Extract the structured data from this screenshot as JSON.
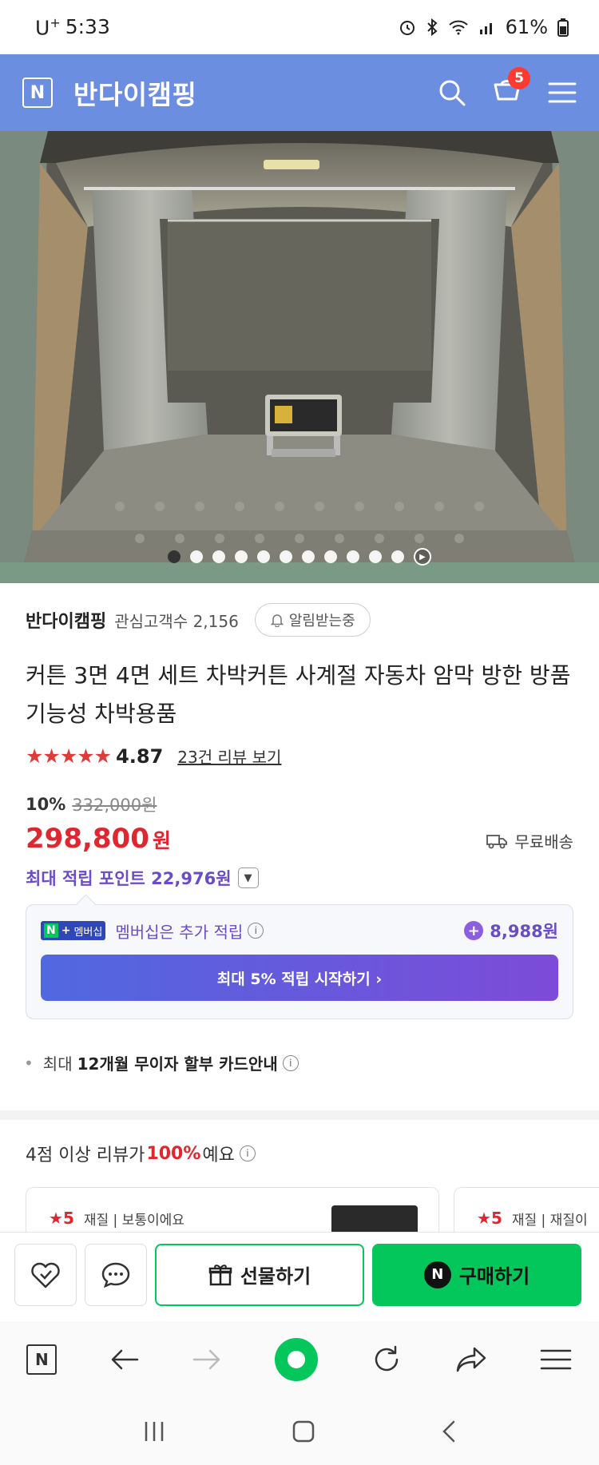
{
  "status_bar": {
    "carrier": "U",
    "carrier_plus": "+",
    "time": "5:33",
    "battery": "61%"
  },
  "header": {
    "logo_letter": "N",
    "store_name": "반다이캠핑",
    "cart_count": "5"
  },
  "gallery": {
    "dot_count": 11,
    "active_index": 0
  },
  "seller": {
    "name": "반다이캠핑",
    "followers_label": "관심고객수",
    "followers_count": "2,156",
    "alarm_label": "알림받는중"
  },
  "product": {
    "title": "커튼 3면 4면 세트 차박커튼 사계절 자동차 암막 방한 방품 기능성 차박용품",
    "stars": "★★★★★",
    "rating": "4.87",
    "review_link": "23건 리뷰 보기",
    "discount_rate": "10%",
    "original_price": "332,000원",
    "price": "298,800",
    "price_unit": "원",
    "shipping": "무료배송",
    "max_points": "최대 적립 포인트 22,976원"
  },
  "membership": {
    "badge_n": "N",
    "badge_plus": "+",
    "badge_label": "멤버십",
    "text": "멤버십은 추가 적립",
    "points": "8,988원",
    "cta": "최대 5% 적립 시작하기 ›"
  },
  "installment": {
    "prefix": "최대",
    "bold": "12개월 무이자 할부 카드안내"
  },
  "review_summary": {
    "prefix": "4점 이상 리뷰가",
    "percent": "100%",
    "suffix": "예요"
  },
  "review_cards": [
    {
      "rating": "5",
      "text": "재질 | 보통이에요"
    },
    {
      "rating": "5",
      "text": "재질 | 재질이"
    }
  ],
  "buy_bar": {
    "gift_label": "선물하기",
    "buy_label": "구매하기",
    "buy_icon": "N"
  },
  "browser": {
    "logo_letter": "N"
  },
  "colors": {
    "header_bg": "#6c8ee0",
    "price_red": "#e0262e",
    "naver_green": "#03c75a",
    "points_purple": "#6b4cc8"
  }
}
